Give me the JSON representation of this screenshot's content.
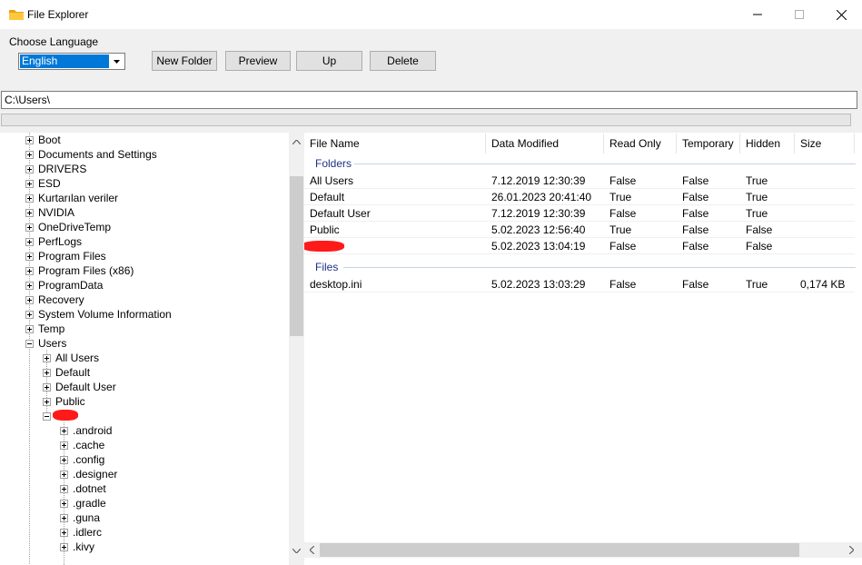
{
  "window": {
    "title": "File Explorer"
  },
  "toolbar": {
    "language_label": "Choose Language",
    "language_selected": "English",
    "new_folder": "New Folder",
    "preview": "Preview",
    "up": "Up",
    "delete": "Delete"
  },
  "path": "C:\\Users\\",
  "tree": {
    "root_items": [
      "Boot",
      "Documents and Settings",
      "DRIVERS",
      "ESD",
      "Kurtarılan veriler",
      "NVIDIA",
      "OneDriveTemp",
      "PerfLogs",
      "Program Files",
      "Program Files (x86)",
      "ProgramData",
      "Recovery",
      "System Volume Information",
      "Temp",
      "Users"
    ],
    "users_children": [
      "All Users",
      "Default",
      "Default User",
      "Public"
    ],
    "redacted_children": [
      ".android",
      ".cache",
      ".config",
      ".designer",
      ".dotnet",
      ".gradle",
      ".guna",
      ".idlerc",
      ".kivy"
    ]
  },
  "list": {
    "columns": [
      "File Name",
      "Data Modified",
      "Read Only",
      "Temporary",
      "Hidden",
      "Size"
    ],
    "folders_label": "Folders",
    "files_label": "Files",
    "folders": [
      [
        "All Users",
        "7.12.2019 12:30:39",
        "False",
        "False",
        "True",
        ""
      ],
      [
        "Default",
        "26.01.2023 20:41:40",
        "True",
        "False",
        "True",
        ""
      ],
      [
        "Default User",
        "7.12.2019 12:30:39",
        "False",
        "False",
        "True",
        ""
      ],
      [
        "Public",
        "5.02.2023 12:56:40",
        "True",
        "False",
        "False",
        ""
      ],
      [
        "",
        "5.02.2023 13:04:19",
        "False",
        "False",
        "False",
        ""
      ]
    ],
    "files": [
      [
        "desktop.ini",
        "5.02.2023 13:03:29",
        "False",
        "False",
        "True",
        "0,174 KB"
      ]
    ]
  },
  "colors": {
    "accent": "#0078d7",
    "group_text": "#1e3287",
    "redaction": "#ff1a1a"
  }
}
